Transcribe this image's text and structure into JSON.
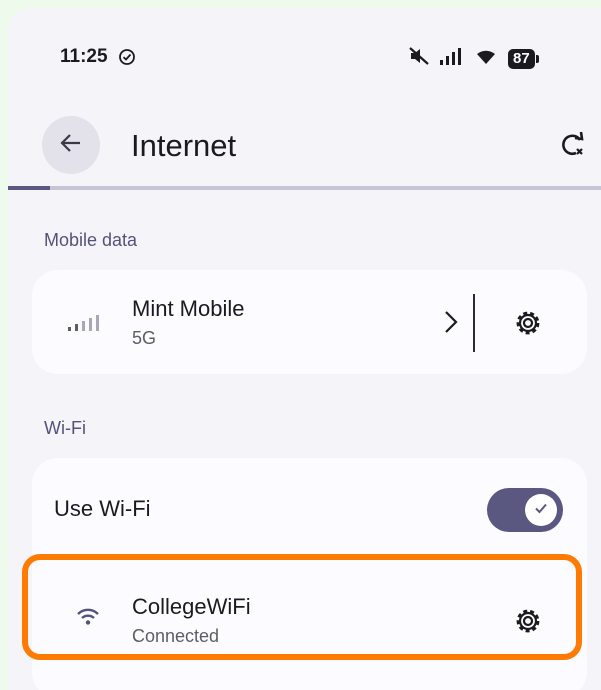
{
  "status_bar": {
    "time": "11:25",
    "battery": "87",
    "icons": [
      "check-circle-icon",
      "mute-icon",
      "signal-icon",
      "wifi-icon",
      "battery-icon"
    ]
  },
  "app_bar": {
    "title": "Internet",
    "back_icon": "back-arrow-icon",
    "refresh_icon": "refresh-icon",
    "loading_progress": 0.07
  },
  "mobile_data": {
    "section_label": "Mobile data",
    "carrier": "Mint Mobile",
    "network_type": "5G"
  },
  "wifi": {
    "section_label": "Wi-Fi",
    "use_wifi_label": "Use Wi-Fi",
    "use_wifi_enabled": true,
    "connected_network": {
      "name": "CollegeWiFi",
      "status": "Connected"
    }
  },
  "colors": {
    "accent": "#5a5880",
    "highlight": "#ff7a00",
    "background": "#f5f4f9",
    "card": "#fcfbff"
  }
}
